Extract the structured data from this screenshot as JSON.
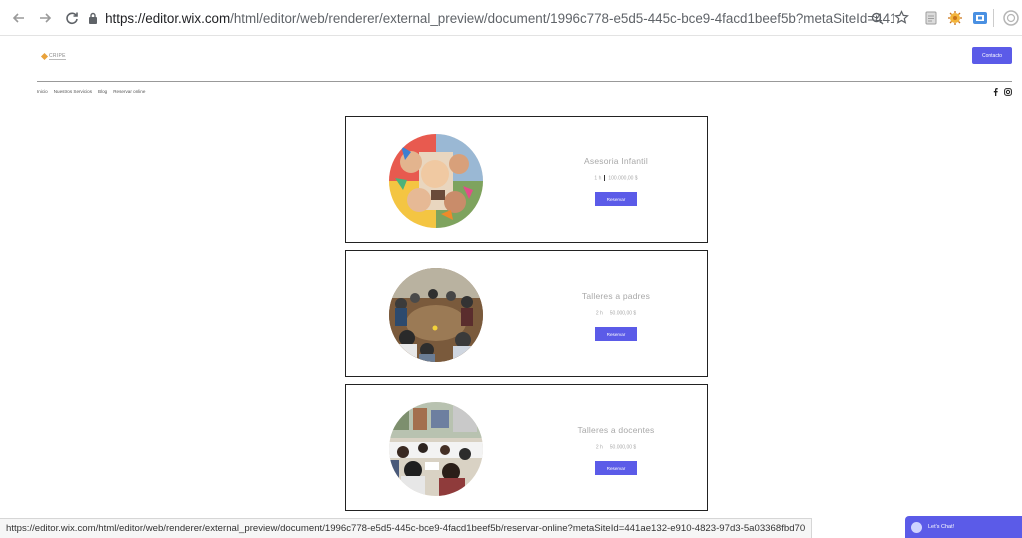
{
  "browser": {
    "url_host": "https://editor.wix.com",
    "url_path": "/html/editor/web/renderer/external_preview/document/1996c778-e5d5-445c-bce9-4facd1beef5b?metaSiteId=441ae132-e910-4823-...",
    "status_url": "https://editor.wix.com/html/editor/web/renderer/external_preview/document/1996c778-e5d5-445c-bce9-4facd1beef5b/reservar-online?metaSiteId=441ae132-e910-4823-97d3-5a03368fbd70"
  },
  "site": {
    "logo_text": "CRIPE",
    "contact_label": "Contacto",
    "menu": [
      "Inicio",
      "Nuestros Servicios",
      "Blog",
      "Reservar online"
    ],
    "social": [
      "facebook-icon",
      "instagram-icon"
    ]
  },
  "services": [
    {
      "title": "Asesoria Infantil",
      "duration": "1 h",
      "price": "100.000,00 $",
      "button": "Reservar"
    },
    {
      "title": "Talleres a padres",
      "duration": "2 h",
      "price": "50.000,00 $",
      "button": "Reservar"
    },
    {
      "title": "Talleres a docentes",
      "duration": "2 h",
      "price": "50.000,00 $",
      "button": "Reservar"
    }
  ],
  "chat": {
    "label": "Let's Chat!"
  },
  "colors": {
    "accent": "#5b5be8"
  }
}
